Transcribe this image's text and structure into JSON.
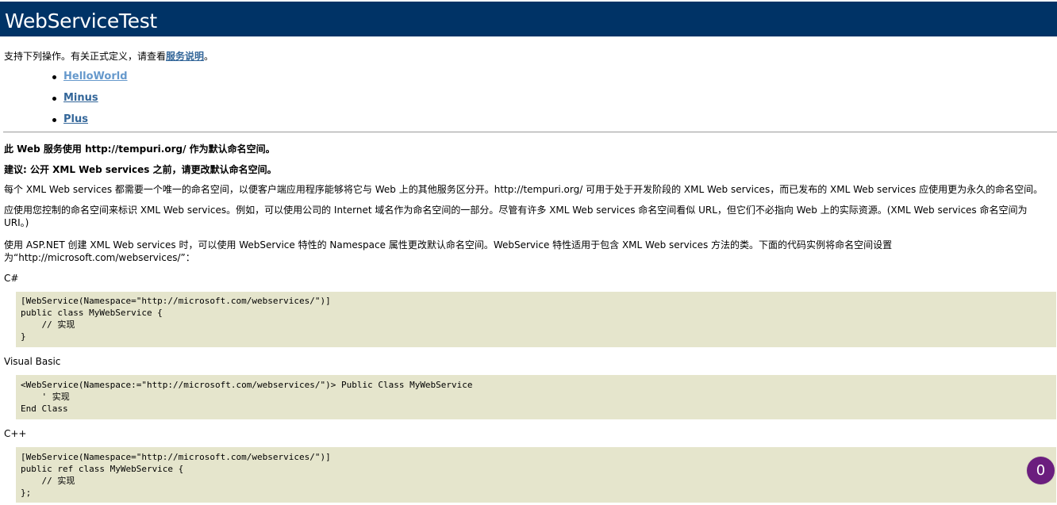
{
  "header": {
    "title": "WebServiceTest"
  },
  "intro": {
    "prefix": "支持下列操作。有关正式定义，请查看",
    "link_text": "服务说明",
    "suffix": "。"
  },
  "operations": [
    "HelloWorld",
    "Minus",
    "Plus"
  ],
  "namespace_notice": {
    "line1": "此 Web 服务使用 http://tempuri.org/ 作为默认命名空间。",
    "line2": "建议: 公开 XML Web services 之前，请更改默认命名空间。"
  },
  "paragraphs": [
    "每个 XML Web services 都需要一个唯一的命名空间，以便客户端应用程序能够将它与 Web 上的其他服务区分开。http://tempuri.org/ 可用于处于开发阶段的 XML Web services，而已发布的 XML Web services 应使用更为永久的命名空间。",
    "应使用您控制的命名空间来标识 XML Web services。例如，可以使用公司的 Internet 域名作为命名空间的一部分。尽管有许多 XML Web services 命名空间看似 URL，但它们不必指向 Web 上的实际资源。(XML Web services 命名空间为 URI。)",
    "使用 ASP.NET 创建 XML Web services 时，可以使用 WebService 特性的 Namespace 属性更改默认命名空间。WebService 特性适用于包含 XML Web services 方法的类。下面的代码实例将命名空间设置为“http://microsoft.com/webservices/”："
  ],
  "examples": [
    {
      "label": "C#",
      "code": "[WebService(Namespace=\"http://microsoft.com/webservices/\")]\npublic class MyWebService {\n    // 实现\n}"
    },
    {
      "label": "Visual Basic",
      "code": "<WebService(Namespace:=\"http://microsoft.com/webservices/\")> Public Class MyWebService\n    ' 实现\nEnd Class"
    },
    {
      "label": "C++",
      "code": "[WebService(Namespace=\"http://microsoft.com/webservices/\")]\npublic ref class MyWebService {\n    // 实现\n};"
    }
  ],
  "badge": {
    "count": "0"
  },
  "colors": {
    "header_bg": "#003366",
    "link": "#336699",
    "visited_link": "#6699cc",
    "code_bg": "#e5e5cc",
    "badge_bg": "#6b1e7e"
  }
}
